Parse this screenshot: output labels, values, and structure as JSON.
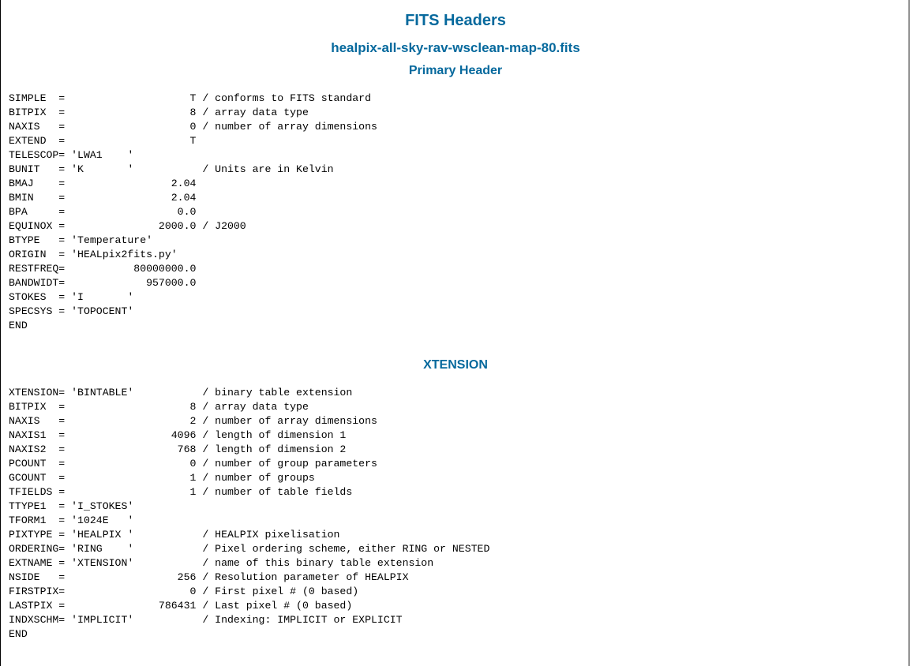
{
  "page": {
    "title": "FITS Headers",
    "filename": "healpix-all-sky-rav-wsclean-map-80.fits"
  },
  "primary": {
    "heading": "Primary Header",
    "lines": [
      "SIMPLE  =                    T / conforms to FITS standard",
      "BITPIX  =                    8 / array data type",
      "NAXIS   =                    0 / number of array dimensions",
      "EXTEND  =                    T",
      "TELESCOP= 'LWA1    '",
      "BUNIT   = 'K       '           / Units are in Kelvin",
      "BMAJ    =                 2.04",
      "BMIN    =                 2.04",
      "BPA     =                  0.0",
      "EQUINOX =               2000.0 / J2000",
      "BTYPE   = 'Temperature'",
      "ORIGIN  = 'HEALpix2fits.py'",
      "RESTFREQ=           80000000.0",
      "BANDWIDT=             957000.0",
      "STOKES  = 'I       '",
      "SPECSYS = 'TOPOCENT'",
      "END"
    ]
  },
  "xtension": {
    "heading": "XTENSION",
    "lines": [
      "XTENSION= 'BINTABLE'           / binary table extension",
      "BITPIX  =                    8 / array data type",
      "NAXIS   =                    2 / number of array dimensions",
      "NAXIS1  =                 4096 / length of dimension 1",
      "NAXIS2  =                  768 / length of dimension 2",
      "PCOUNT  =                    0 / number of group parameters",
      "GCOUNT  =                    1 / number of groups",
      "TFIELDS =                    1 / number of table fields",
      "TTYPE1  = 'I_STOKES'",
      "TFORM1  = '1024E   '",
      "PIXTYPE = 'HEALPIX '           / HEALPIX pixelisation",
      "ORDERING= 'RING    '           / Pixel ordering scheme, either RING or NESTED",
      "EXTNAME = 'XTENSION'           / name of this binary table extension",
      "NSIDE   =                  256 / Resolution parameter of HEALPIX",
      "FIRSTPIX=                    0 / First pixel # (0 based)",
      "LASTPIX =               786431 / Last pixel # (0 based)",
      "INDXSCHM= 'IMPLICIT'           / Indexing: IMPLICIT or EXPLICIT",
      "END"
    ]
  },
  "colors": {
    "heading": "#06699d",
    "text": "#000000",
    "background": "#ffffff"
  }
}
